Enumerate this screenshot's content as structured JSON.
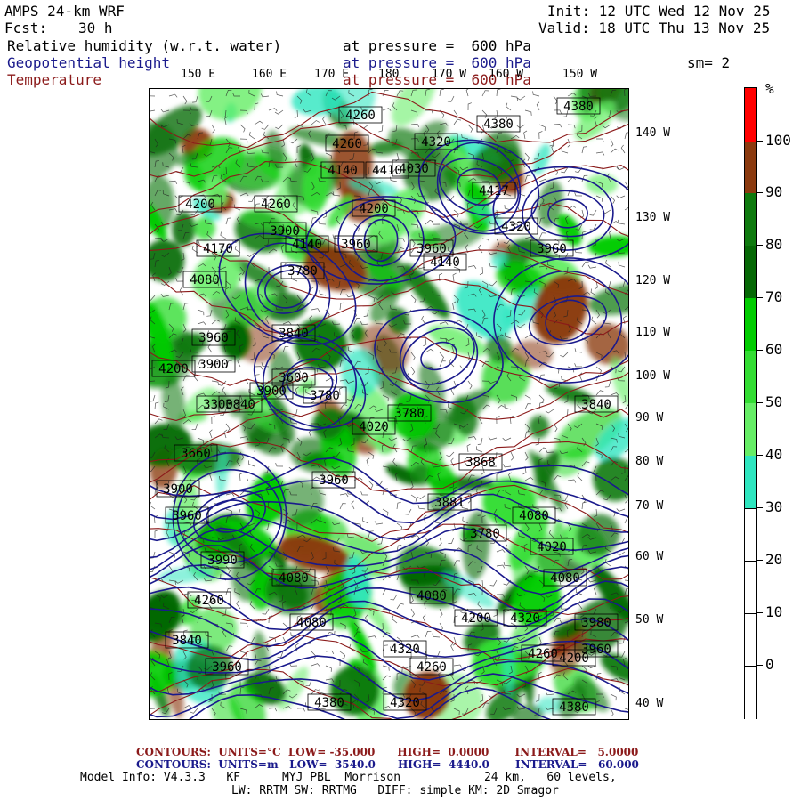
{
  "header": {
    "model": "AMPS 24-km WRF",
    "init": "Init: 12 UTC Wed 12 Nov 25",
    "fcst_label": "Fcst:",
    "fcst_value": "30 h",
    "valid": "Valid: 18 UTC Thu 13 Nov 25",
    "field1_name": "Relative humidity (w.r.t. water)",
    "field1_level": "at pressure =  600 hPa",
    "field2_name": "Geopotential height",
    "field2_level": "at pressure =  600 hPa",
    "field3_name": "Temperature",
    "field3_level": "at pressure =  600 hPa",
    "smoothing": "sm= 2"
  },
  "longitude_labels_top": [
    "150 E",
    "160 E",
    "170 E",
    "180",
    "170 W",
    "160 W",
    "150 W"
  ],
  "longitude_labels_right": [
    "140 W",
    "130 W",
    "120 W",
    "110 W",
    "100 W",
    "90 W",
    "80 W",
    "70 W",
    "60 W",
    "50 W",
    "40 W"
  ],
  "colorbar": {
    "unit": "%",
    "labels": [
      "100",
      "90",
      "80",
      "70",
      "60",
      "50",
      "40",
      "30",
      "20",
      "10",
      "0"
    ],
    "segments": [
      {
        "range": "100+",
        "color": "#ff0000"
      },
      {
        "range": "90-100",
        "color": "#8b3a0f"
      },
      {
        "range": "80-90",
        "color": "#0e7a0e"
      },
      {
        "range": "70-80",
        "color": "#056805"
      },
      {
        "range": "60-70",
        "color": "#00cc00"
      },
      {
        "range": "50-60",
        "color": "#33dd33"
      },
      {
        "range": "40-50",
        "color": "#66ee66"
      },
      {
        "range": "30-40",
        "color": "#2ee6c0"
      },
      {
        "range": "20-30",
        "color": "#ffffff"
      },
      {
        "range": "10-20",
        "color": "#ffffff"
      },
      {
        "range": "0-10",
        "color": "#ffffff"
      },
      {
        "range": "<0",
        "color": "#ffffff"
      }
    ]
  },
  "height_labels": [
    "4260",
    "4380",
    "4320",
    "4380",
    "4260",
    "4410",
    "4140",
    "4030",
    "4417",
    "4320",
    "4200",
    "4260",
    "4200",
    "3960",
    "4170",
    "3960",
    "4140",
    "3960",
    "3900",
    "4080",
    "4140",
    "3960",
    "3780",
    "3900",
    "3840",
    "4200",
    "3600",
    "3900",
    "3300",
    "3780",
    "3780",
    "3840",
    "4020",
    "3840",
    "3660",
    "3900",
    "3960",
    "3990",
    "3960",
    "3868",
    "3881",
    "3780",
    "4080",
    "4020",
    "4080",
    "4260",
    "4080",
    "3840",
    "3960",
    "4080",
    "3980",
    "4080",
    "4200",
    "4320",
    "4260",
    "3960",
    "4320",
    "4200",
    "4260",
    "4380",
    "4320",
    "4380"
  ],
  "footer": {
    "temp_contours": "CONTOURS:  UNITS=°C  LOW= -35.000      HIGH=  0.0000       INTERVAL=   5.0000",
    "height_contours": "CONTOURS:  UNITS=m   LOW=  3540.0      HIGH=  4440.0       INTERVAL=   60.000",
    "model_info_1": "Model Info: V4.3.3   KF      MYJ PBL  Morrison            24 km,   60 levels,",
    "model_info_2": "LW: RRTM SW: RRTMG   DIFF: simple KM: 2D Smagor"
  },
  "colors": {
    "height_contour": "#1a1a8c",
    "temp_contour": "#8b1a1a"
  }
}
